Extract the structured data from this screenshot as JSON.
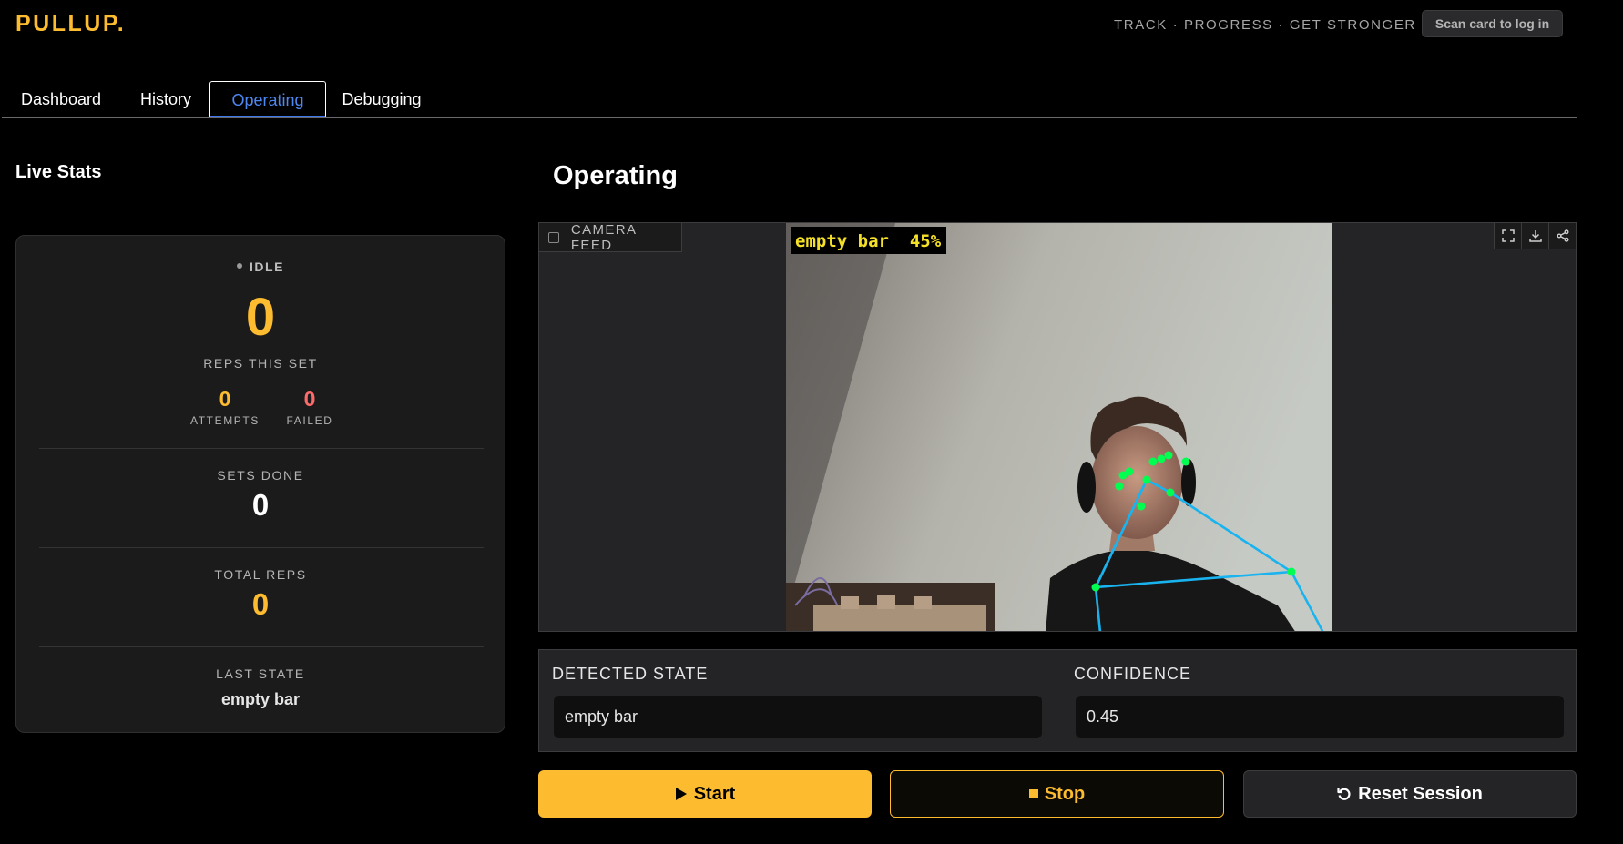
{
  "header": {
    "logo": "PULLUP.",
    "tagline": "TRACK · PROGRESS · GET STRONGER",
    "scan_button": "Scan card to log in"
  },
  "tabs": [
    {
      "label": "Dashboard",
      "active": false
    },
    {
      "label": "History",
      "active": false
    },
    {
      "label": "Operating",
      "active": true
    },
    {
      "label": "Debugging",
      "active": false
    }
  ],
  "live_stats": {
    "title": "Live Stats",
    "status": "IDLE",
    "reps_this_set": "0",
    "reps_this_set_label": "REPS THIS SET",
    "attempts": "0",
    "attempts_label": "ATTEMPTS",
    "failed": "0",
    "failed_label": "FAILED",
    "sets_done_label": "SETS DONE",
    "sets_done": "0",
    "total_reps_label": "TOTAL REPS",
    "total_reps": "0",
    "last_state_label": "LAST STATE",
    "last_state": "empty bar"
  },
  "operating": {
    "title": "Operating",
    "feed_label": "CAMERA FEED",
    "overlay_text": "empty bar  45%",
    "tools": [
      "fullscreen-icon",
      "download-icon",
      "share-icon"
    ],
    "detected_state_label": "DETECTED STATE",
    "detected_state": "empty bar",
    "confidence_label": "CONFIDENCE",
    "confidence": "0.45"
  },
  "controls": {
    "start": "Start",
    "stop": "Stop",
    "reset": "Reset Session"
  },
  "colors": {
    "accent": "#fdbb30",
    "failed": "#ff6b6b",
    "active_tab": "#4f87f0",
    "keypoint": "#00ff50",
    "skeleton": "#19b4f0"
  }
}
